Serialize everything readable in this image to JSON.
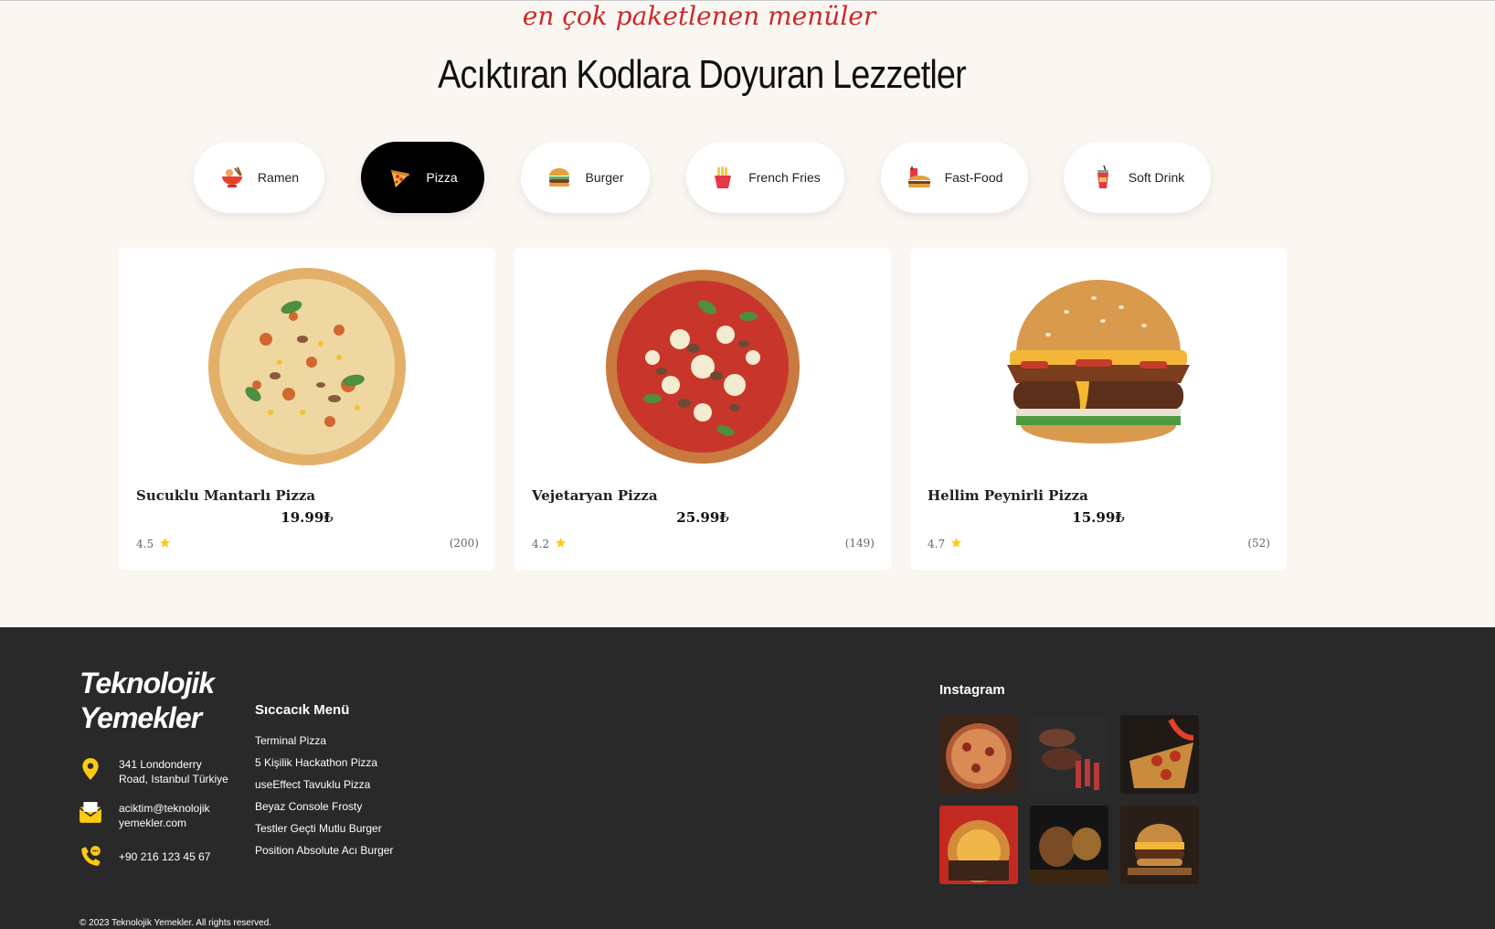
{
  "header": {
    "script_title": "en çok paketlenen menüler",
    "main_title": "Acıktıran Kodlara Doyuran Lezzetler"
  },
  "categories": [
    {
      "label": "Ramen",
      "icon": "ramen-icon",
      "active": false
    },
    {
      "label": "Pizza",
      "icon": "pizza-icon",
      "active": true
    },
    {
      "label": "Burger",
      "icon": "burger-icon",
      "active": false
    },
    {
      "label": "French Fries",
      "icon": "fries-icon",
      "active": false
    },
    {
      "label": "Fast-Food",
      "icon": "fastfood-icon",
      "active": false
    },
    {
      "label": "Soft Drink",
      "icon": "soft-drink-icon",
      "active": false
    }
  ],
  "products": [
    {
      "name": "Sucuklu Mantarlı Pizza",
      "price": "19.99₺",
      "rating": "4.5",
      "reviews": "(200)",
      "image": "pizza-image"
    },
    {
      "name": "Vejetaryan Pizza",
      "price": "25.99₺",
      "rating": "4.2",
      "reviews": "(149)",
      "image": "pizza-image"
    },
    {
      "name": "Hellim Peynirli Pizza",
      "price": "15.99₺",
      "rating": "4.7",
      "reviews": "(52)",
      "image": "burger-image"
    }
  ],
  "footer": {
    "brand_line1": "Teknolojik",
    "brand_line2": "Yemekler",
    "address": "341 Londonderry Road, Istanbul Türkiye",
    "email": "aciktim@teknolojik yemekler.com",
    "phone": "+90 216 123 45 67",
    "menu_title": "Sıccacık Menü",
    "menu_items": [
      "Terminal Pizza",
      "5 Kişilik Hackathon Pizza",
      "useEffect Tavuklu Pizza",
      "Beyaz Console Frosty",
      "Testler Geçti Mutlu Burger",
      "Position Absolute Acı Burger"
    ],
    "instagram_title": "Instagram",
    "copyright": "© 2023 Teknolojik Yemekler. All rights reserved."
  },
  "colors": {
    "accent_red": "#ce2829",
    "accent_yellow": "#fdc913",
    "footer_bg": "#292929",
    "page_bg": "#faf7f2"
  }
}
